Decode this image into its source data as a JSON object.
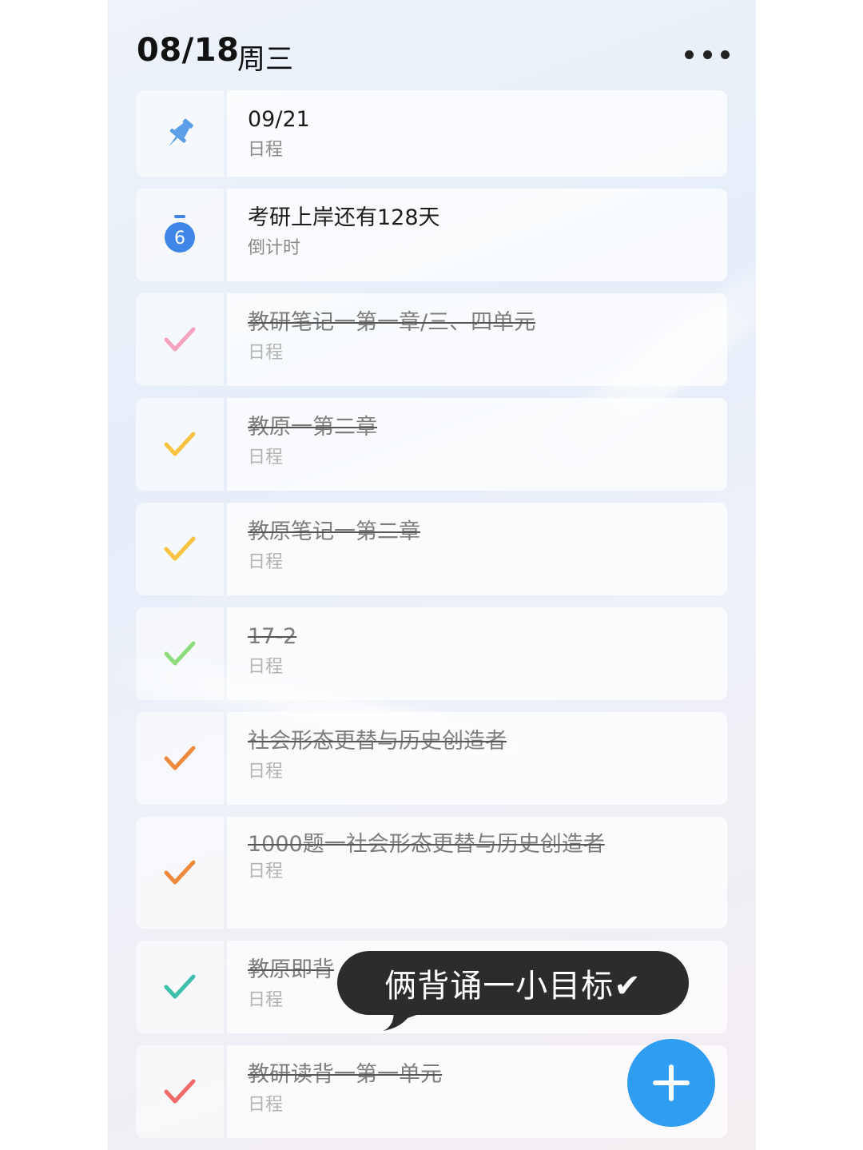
{
  "header": {
    "date": "08/18",
    "weekday": "周三",
    "more_icon": "more-dots-icon"
  },
  "items": [
    {
      "icon": "pin-icon",
      "icon_color": "#5b9ee8",
      "title": "09/21",
      "subtitle": "日程",
      "done": false
    },
    {
      "icon": "countdown-timer-icon",
      "icon_color": "#3f86e6",
      "icon_text": "6",
      "title": "考研上岸还有128天",
      "subtitle": "倒计时",
      "done": false
    },
    {
      "icon": "check-icon",
      "icon_color": "#f5a3bf",
      "title": "教研笔记一第一章/三、四单元",
      "subtitle": "日程",
      "done": true
    },
    {
      "icon": "check-icon",
      "icon_color": "#f7c340",
      "title": "教原一第二章",
      "subtitle": "日程",
      "done": true
    },
    {
      "icon": "check-icon",
      "icon_color": "#f7c340",
      "title": "教原笔记一第二章",
      "subtitle": "日程",
      "done": true
    },
    {
      "icon": "check-icon",
      "icon_color": "#8fdc7e",
      "title": "17-2",
      "subtitle": "日程",
      "done": true
    },
    {
      "icon": "check-icon",
      "icon_color": "#ef8a3c",
      "title": "社会形态更替与历史创造者",
      "subtitle": "日程",
      "done": true
    },
    {
      "icon": "check-icon",
      "icon_color": "#ef8a3c",
      "title": "1000题一社会形态更替与历史创造者",
      "subtitle": "日程",
      "done": true
    },
    {
      "icon": "check-icon",
      "icon_color": "#3fc0ad",
      "title": "教原即背",
      "subtitle": "日程",
      "done": true
    },
    {
      "icon": "check-icon",
      "icon_color": "#f26a6a",
      "title": "教研读背一第一单元",
      "subtitle": "日程",
      "done": true
    }
  ],
  "tooltip": {
    "text": "俩背诵一小目标✔"
  },
  "fab": {
    "icon": "plus-icon",
    "color": "#2f9df1"
  }
}
